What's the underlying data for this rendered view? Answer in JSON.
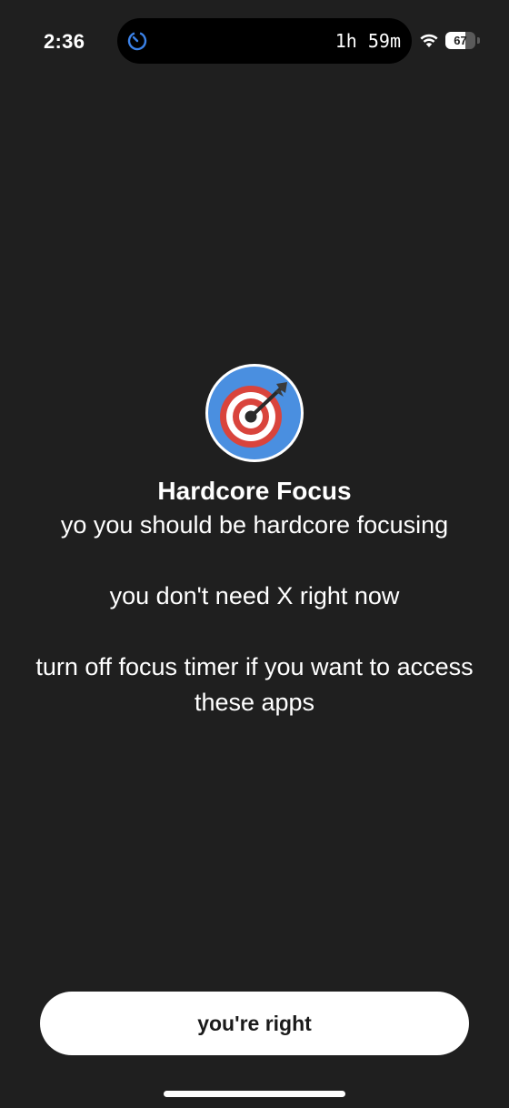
{
  "status_bar": {
    "time": "2:36",
    "countdown": "1h 59m",
    "battery_level": "67",
    "battery_fraction": 0.67,
    "timer_icon_color": "#3b82e8",
    "timer_icon": "timer-icon",
    "wifi_icon": "wifi-icon"
  },
  "app": {
    "name": "Hardcore Focus",
    "icon": "target-dart-icon",
    "icon_colors": {
      "background": "#4a8fe0",
      "ring_red": "#d9443c",
      "ring_white": "#ffffff"
    }
  },
  "message": {
    "line1": "yo you should be hardcore focusing",
    "line2": "you don't need X right now",
    "line3": "turn off focus timer if you want to access these apps"
  },
  "actions": {
    "confirm_label": "you're right"
  },
  "colors": {
    "background": "#1f1f1f",
    "text": "#ffffff",
    "button_bg": "#ffffff",
    "button_text": "#1a1a1a"
  }
}
